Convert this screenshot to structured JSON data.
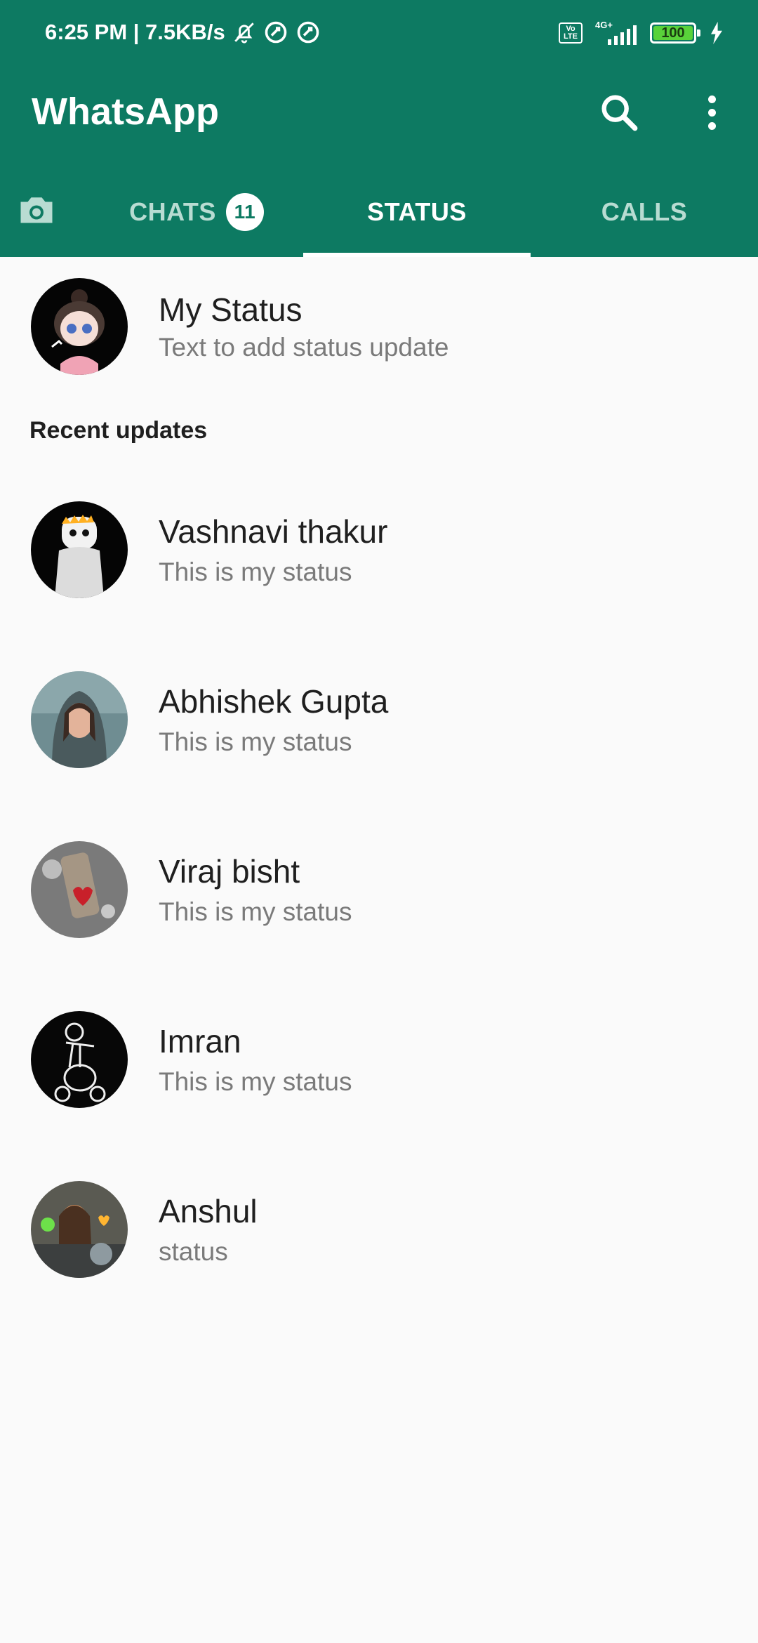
{
  "status_bar": {
    "time_and_speed": "6:25 PM | 7.5KB/s",
    "volte_label": "Vo\nLTE",
    "network_type": "4G+",
    "battery_level": "100"
  },
  "app_bar": {
    "title": "WhatsApp"
  },
  "tabs": {
    "chats": "CHATS",
    "chats_badge": "11",
    "status": "STATUS",
    "calls": "CALLS",
    "active": "STATUS"
  },
  "my_status": {
    "name": "My Status",
    "subtitle": "Text to add status update"
  },
  "recent_label": "Recent updates",
  "contacts": [
    {
      "name": "Vashnavi thakur",
      "status": "This is my status"
    },
    {
      "name": "Abhishek Gupta",
      "status": "This is my status"
    },
    {
      "name": "Viraj bisht",
      "status": "This is my status"
    },
    {
      "name": "Imran",
      "status": "This is my status"
    },
    {
      "name": "Anshul",
      "status": "status"
    }
  ],
  "colors": {
    "primary": "#0d7a62",
    "background": "#fafafa",
    "tab_inactive": "#b8dcd2"
  }
}
